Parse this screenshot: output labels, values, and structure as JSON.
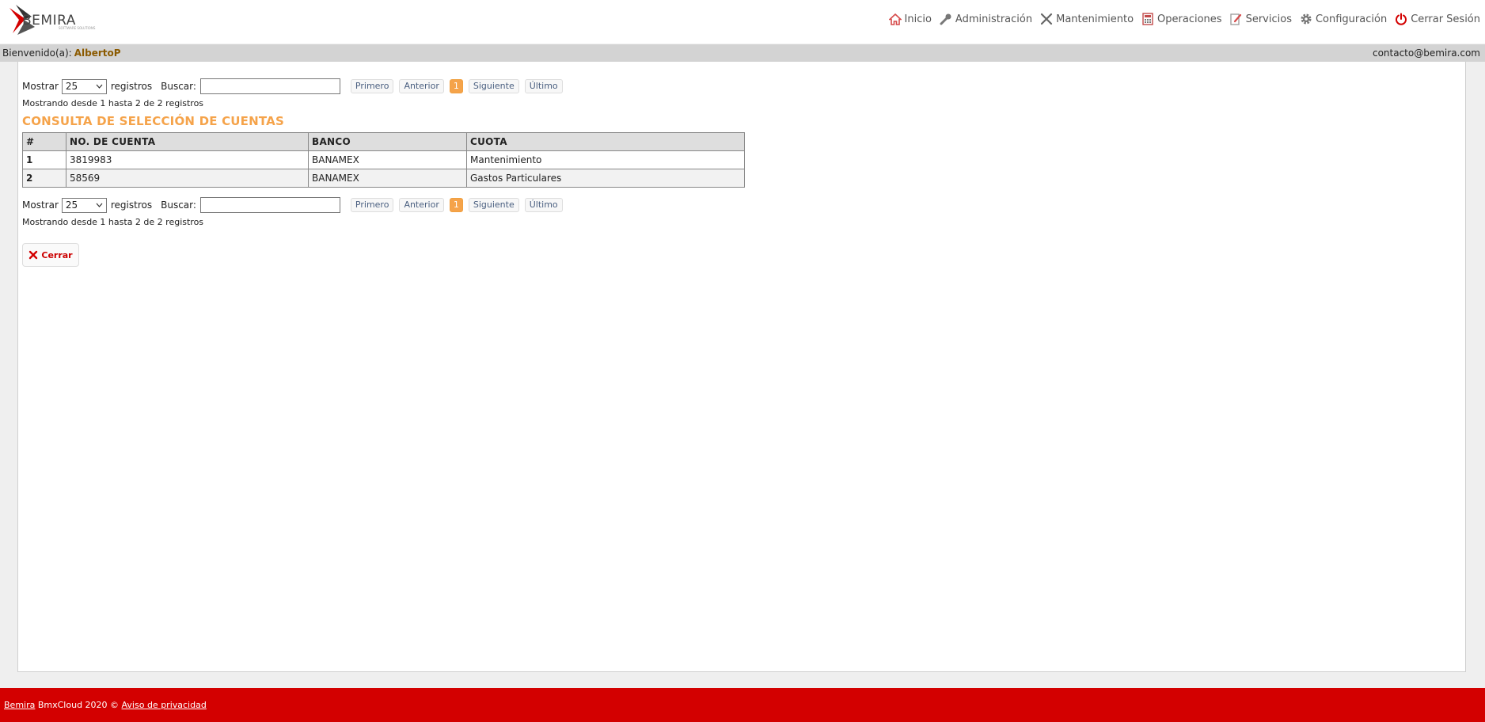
{
  "header": {
    "logo_text": "BEMIRA",
    "nav": [
      {
        "label": "Inicio",
        "icon": "home-icon"
      },
      {
        "label": "Administración",
        "icon": "wrench-key-icon"
      },
      {
        "label": "Mantenimiento",
        "icon": "tools-icon"
      },
      {
        "label": "Operaciones",
        "icon": "calculator-icon"
      },
      {
        "label": "Servicios",
        "icon": "edit-document-icon"
      },
      {
        "label": "Configuración",
        "icon": "gear-icon"
      },
      {
        "label": "Cerrar Sesión",
        "icon": "power-icon"
      }
    ]
  },
  "welcome": {
    "prefix": "Bienvenido(a):",
    "user": "AlbertoP",
    "email": "contacto@bemira.com"
  },
  "controls": {
    "show_label": "Mostrar",
    "page_size": "25",
    "records_label": "registros",
    "search_label": "Buscar:",
    "search_value": "",
    "pager": {
      "first": "Primero",
      "prev": "Anterior",
      "current": "1",
      "next": "Siguiente",
      "last": "Último"
    },
    "info": "Mostrando desde 1 hasta 2 de 2 registros"
  },
  "title": "CONSULTA DE SELECCIÓN DE CUENTAS",
  "table": {
    "headers": [
      "#",
      "NO. DE CUENTA",
      "BANCO",
      "CUOTA"
    ],
    "rows": [
      [
        "1",
        "3819983",
        "BANAMEX",
        "Mantenimiento"
      ],
      [
        "2",
        "58569",
        "BANAMEX",
        "Gastos Particulares"
      ]
    ]
  },
  "close_label": "Cerrar",
  "footer": {
    "brand": "Bemira",
    "text": " BmxCloud 2020 © ",
    "privacy": "Aviso de privacidad"
  },
  "colors": {
    "accent": "#f5a34a",
    "footer_bg": "#d30000",
    "user_name": "#8b5a00"
  }
}
